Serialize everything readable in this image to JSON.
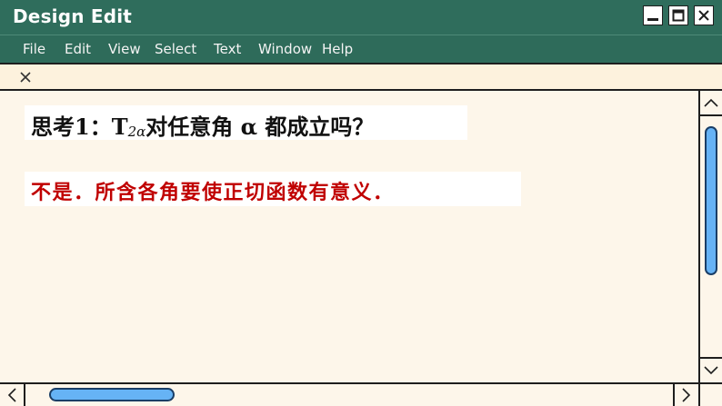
{
  "window": {
    "title": "Design Edit"
  },
  "menu": {
    "items": [
      "File",
      "Edit",
      "View",
      "Select",
      "Text",
      "Window",
      "Help"
    ]
  },
  "tab": {
    "close_icon": "close-icon"
  },
  "content": {
    "line1_prefix": "思考1：T",
    "line1_sub": "2α",
    "line1_suffix": "对任意角 α 都成立吗？",
    "line2": "不是．所含各角要使正切函数有意义．"
  },
  "colors": {
    "titlebar": "#2f6d5c",
    "content_bg": "#fdf6ea",
    "answer_text": "#c00000",
    "scroll_thumb": "#66b3f5"
  }
}
